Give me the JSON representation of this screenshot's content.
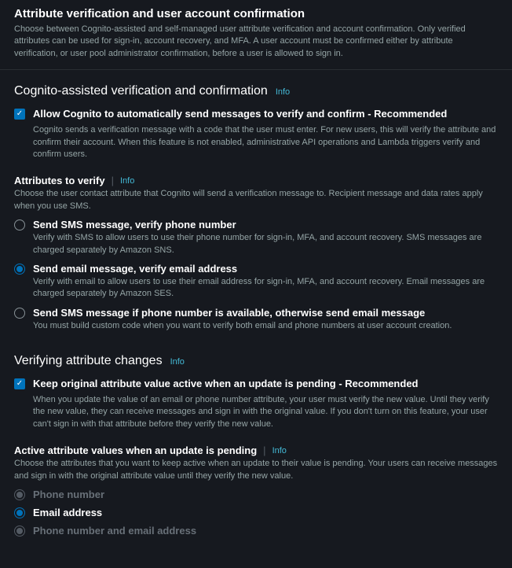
{
  "header": {
    "title": "Attribute verification and user account confirmation",
    "description": "Choose between Cognito-assisted and self-managed user attribute verification and account confirmation. Only verified attributes can be used for sign-in, account recovery, and MFA. A user account must be confirmed either by attribute verification, or user pool administrator confirmation, before a user is allowed to sign in."
  },
  "info_label": "Info",
  "section1": {
    "title": "Cognito-assisted verification and confirmation",
    "allow_auto": {
      "label": "Allow Cognito to automatically send messages to verify and confirm - Recommended",
      "description": "Cognito sends a verification message with a code that the user must enter. For new users, this will verify the attribute and confirm their account. When this feature is not enabled, administrative API operations and Lambda triggers verify and confirm users."
    },
    "attrs_to_verify": {
      "label": "Attributes to verify",
      "description": "Choose the user contact attribute that Cognito will send a verification message to. Recipient message and data rates apply when you use SMS.",
      "options": [
        {
          "label": "Send SMS message, verify phone number",
          "description": "Verify with SMS to allow users to use their phone number for sign-in, MFA, and account recovery. SMS messages are charged separately by Amazon SNS."
        },
        {
          "label": "Send email message, verify email address",
          "description": "Verify with email to allow users to use their email address for sign-in, MFA, and account recovery. Email messages are charged separately by Amazon SES."
        },
        {
          "label": "Send SMS message if phone number is available, otherwise send email message",
          "description": "You must build custom code when you want to verify both email and phone numbers at user account creation."
        }
      ]
    }
  },
  "section2": {
    "title": "Verifying attribute changes",
    "keep_original": {
      "label": "Keep original attribute value active when an update is pending - Recommended",
      "description": "When you update the value of an email or phone number attribute, your user must verify the new value. Until they verify the new value, they can receive messages and sign in with the original value. If you don't turn on this feature, your user can't sign in with that attribute before they verify the new value."
    },
    "active_attrs": {
      "label": "Active attribute values when an update is pending",
      "description": "Choose the attributes that you want to keep active when an update to their value is pending. Your users can receive messages and sign in with the original attribute value until they verify the new value.",
      "options": [
        {
          "label": "Phone number"
        },
        {
          "label": "Email address"
        },
        {
          "label": "Phone number and email address"
        }
      ]
    }
  }
}
